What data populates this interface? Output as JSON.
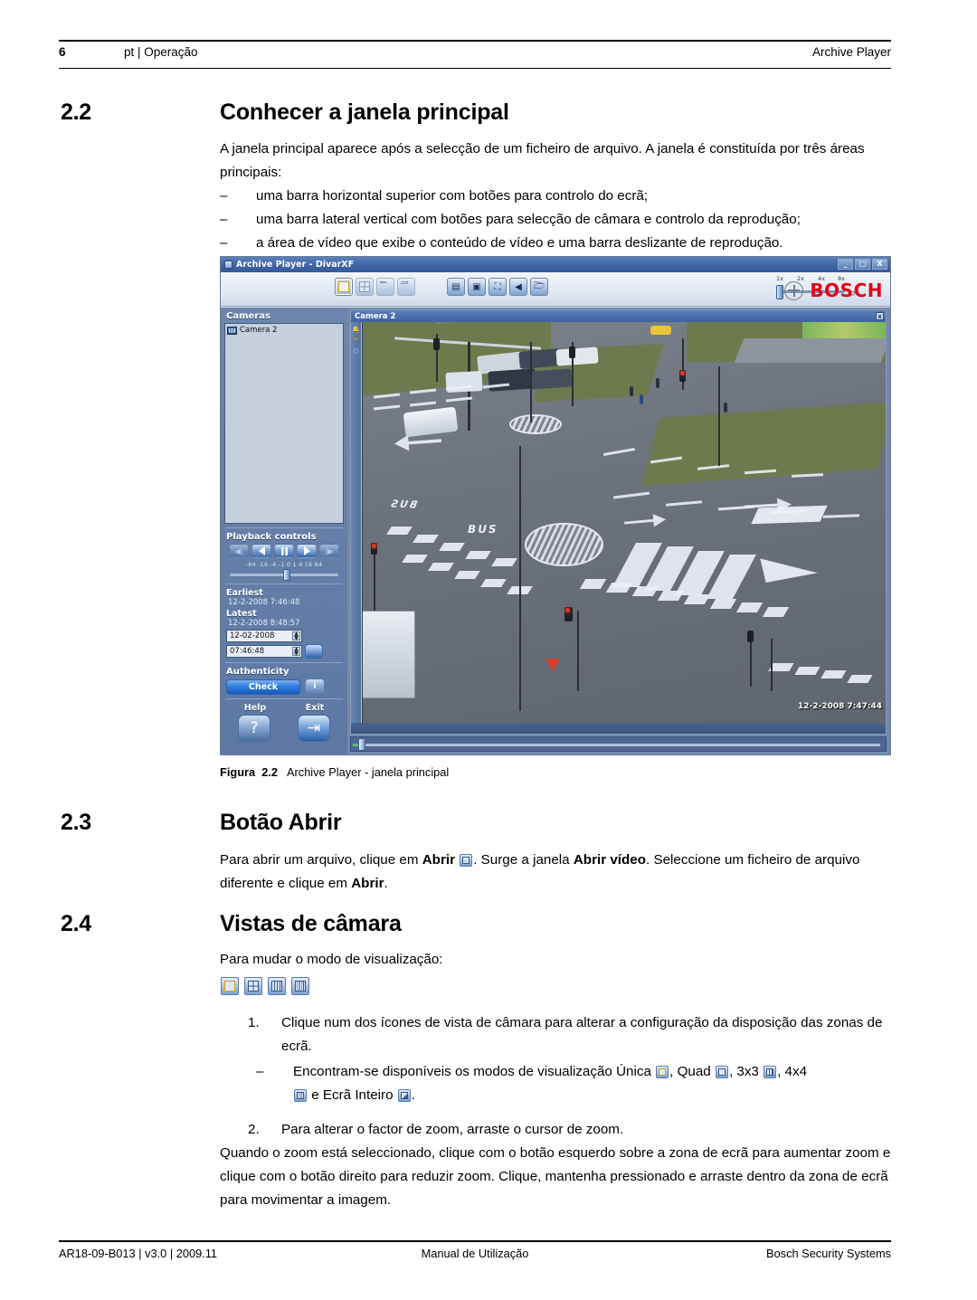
{
  "header": {
    "page_number": "6",
    "section": "pt | Operação",
    "product": "Archive Player"
  },
  "sections": [
    {
      "number": "2.2",
      "title": "Conhecer a janela principal",
      "intro": "A janela principal aparece após a selecção de um ficheiro de arquivo. A janela é constituída por três áreas principais:",
      "bullets": [
        "uma barra horizontal superior com botões para controlo do ecrã;",
        "uma barra lateral vertical com botões para selecção de câmara e controlo da reprodução;",
        "a área de vídeo que exibe o conteúdo de vídeo e uma barra deslizante de reprodução."
      ]
    },
    {
      "number": "2.3",
      "title": "Botão Abrir",
      "para_1a": "Para abrir um arquivo, clique em ",
      "para_1b": "Abrir",
      "para_1c": ". Surge a janela ",
      "para_1d": "Abrir vídeo",
      "para_1e": ". Seleccione um ficheiro de arquivo diferente e clique em ",
      "para_1f": "Abrir",
      "para_1g": "."
    },
    {
      "number": "2.4",
      "title": "Vistas de câmara",
      "intro": "Para mudar o modo de visualização:",
      "step_1_num": "1.",
      "step_1": "Clique num dos ícones de vista de câmara para alterar a configuração da disposição das zonas de ecrã.",
      "sub_dash": "–",
      "sub_a": "Encontram-se disponíveis os modos de visualização Única ",
      "sub_b": ", Quad ",
      "sub_c": ", 3x3 ",
      "sub_d": ", 4x4",
      "sub_e": " e Ecrã Inteiro ",
      "sub_f": ".",
      "step_2_num": "2.",
      "step_2": "Para alterar o factor de zoom, arraste o cursor de zoom.",
      "closing": "Quando o zoom está seleccionado, clique com o botão esquerdo sobre a zona de ecrã para aumentar zoom e clique com o botão direito para reduzir zoom. Clique, mantenha pressionado e arraste dentro da zona de ecrã para movimentar a imagem."
    }
  ],
  "figure": {
    "label": "Figura",
    "number": "2.2",
    "caption": "Archive Player - janela principal"
  },
  "screenshot": {
    "title_bar": "Archive Player - DivarXF",
    "window_buttons": {
      "minimize": "_",
      "maximize": "□",
      "close": "X"
    },
    "brand": {
      "word": "BOSCH",
      "color": "#e2001a"
    },
    "toolbar": {
      "view_icons": [
        "single-view-icon",
        "quad-view-icon",
        "3x3-view-icon",
        "4x4-view-icon"
      ],
      "action_icons": [
        "export-icon",
        "snapshot-icon",
        "fullscreen-icon",
        "audio-icon",
        "open-folder-icon"
      ],
      "zoom_ticks": [
        "1x",
        "2x",
        "4x",
        "8x"
      ],
      "zoom_magnifier": "search-icon"
    },
    "sidebar": {
      "cameras_label": "Cameras",
      "camera_items": [
        "Camera 2"
      ],
      "playback_label": "Playback controls",
      "playback_buttons": [
        "step-back-icon",
        "reverse-play-icon",
        "pause-icon",
        "play-icon",
        "step-forward-icon"
      ],
      "speed_scale": "-64  -16  -4  -1 0 1  4  16  64",
      "earliest_label": "Earliest",
      "earliest_value": "12-2-2008 7:46:48",
      "latest_label": "Latest",
      "latest_value": "12-2-2008 8:48:57",
      "date_field": "12-02-2008",
      "time_field": "07:46:48",
      "goto_button": "goto-icon",
      "authenticity_label": "Authenticity",
      "check_button": "Check",
      "info_button": "i",
      "help_label": "Help",
      "exit_label": "Exit",
      "help_icon": "?",
      "exit_icon": "exit-icon"
    },
    "video": {
      "panel_title": "Camera 2",
      "close_button": "x",
      "timestamp": "12-2-2008 7:47:44",
      "scene_text": [
        "BUS",
        "BUS"
      ]
    }
  },
  "footer": {
    "left": "AR18-09-B013 | v3.0 | 2009.11",
    "center": "Manual de Utilização",
    "right": "Bosch Security Systems"
  }
}
